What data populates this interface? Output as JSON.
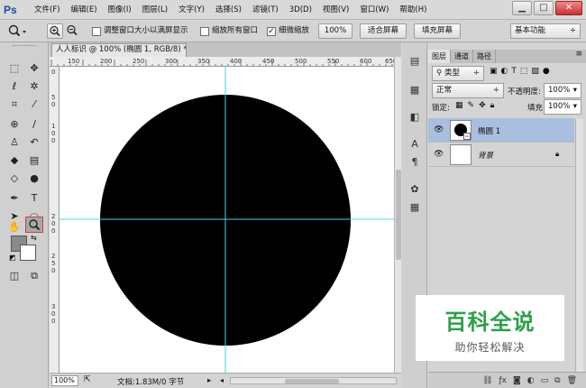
{
  "app": {
    "logo": "Ps",
    "menu": [
      "文件(F)",
      "编辑(E)",
      "图像(I)",
      "图层(L)",
      "文字(Y)",
      "选择(S)",
      "滤镜(T)",
      "3D(D)",
      "视图(V)",
      "窗口(W)",
      "帮助(H)"
    ],
    "window_controls": {
      "minimize": "▁",
      "restore": "□",
      "close": "✕"
    }
  },
  "options": {
    "tool_icon": "zoom-icon",
    "zoom_in_icon": "zoom-in-icon",
    "zoom_out_icon": "zoom-out-icon",
    "resize_windows": {
      "label": "调整窗口大小以满屏显示",
      "checked": false
    },
    "zoom_all": {
      "label": "缩放所有窗口",
      "checked": false
    },
    "scrubby_zoom": {
      "label": "细微缩放",
      "checked": true
    },
    "btn_100": "100%",
    "btn_fit": "适合屏幕",
    "btn_fill": "填充屏幕",
    "workspace": "基本功能"
  },
  "document": {
    "tab_title": "人人标识 @ 100% (椭圆 1, RGB/8) *",
    "tab_close": "×",
    "ruler_h": [
      "150",
      "200",
      "250",
      "300",
      "350",
      "400",
      "450",
      "500",
      "550",
      "600",
      "650"
    ],
    "ruler_v": [
      "0",
      "5",
      "0",
      "1",
      "0",
      "0",
      "2",
      "0",
      "0",
      "2",
      "5",
      "0",
      "3",
      "0",
      "0"
    ],
    "zoom": "100%",
    "doc_info": "文档:1.83M/0 字节",
    "shape_color": "#000000",
    "guide_color": "#4dd2e6"
  },
  "layers_panel": {
    "tabs": [
      "图层",
      "通道",
      "路径"
    ],
    "filter_kind": "类型",
    "blend_mode": "正常",
    "opacity_label": "不透明度:",
    "opacity_value": "100%",
    "lock_label": "锁定:",
    "fill_label": "填充:",
    "fill_value": "100%",
    "layers": [
      {
        "name": "椭圆 1",
        "visible": true,
        "selected": true
      },
      {
        "name": "背景",
        "visible": true,
        "selected": false,
        "locked": true
      }
    ]
  },
  "watermark": {
    "title": "百科全说",
    "subtitle": "助你轻松解决"
  }
}
